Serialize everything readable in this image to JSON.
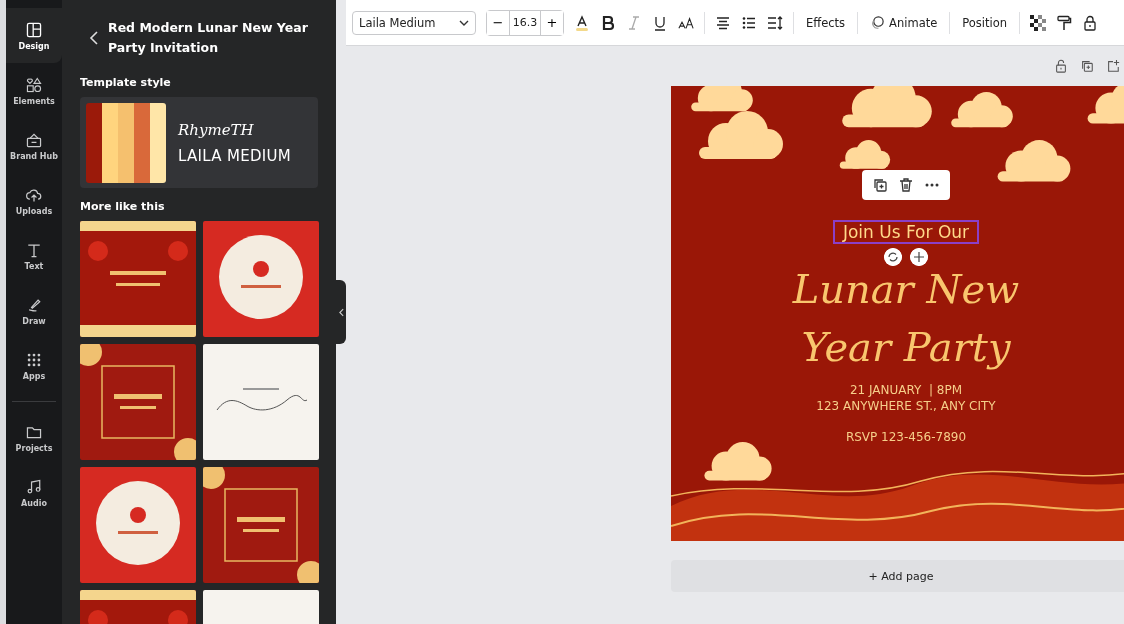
{
  "rail": [
    {
      "label": "Design",
      "selected": true
    },
    {
      "label": "Elements",
      "selected": false
    },
    {
      "label": "Brand Hub",
      "selected": false
    },
    {
      "label": "Uploads",
      "selected": false
    },
    {
      "label": "Text",
      "selected": false
    },
    {
      "label": "Draw",
      "selected": false
    },
    {
      "label": "Apps",
      "selected": false
    },
    {
      "label": "Projects",
      "selected": false
    },
    {
      "label": "Audio",
      "selected": false
    }
  ],
  "panel": {
    "title": "Red Modern Lunar New Year Party Invitation",
    "style_heading": "Template style",
    "swatches": [
      {
        "color": "#9b1a0a"
      },
      {
        "color": "#ffd47e"
      },
      {
        "color": "#f5c06e"
      },
      {
        "color": "#d9693a"
      },
      {
        "color": "#ffe6a8"
      }
    ],
    "script_font": "RhymeTH",
    "font": "LAILA MEDIUM",
    "more_heading": "More like this",
    "thumbnails": [
      {
        "kind": "lanterns"
      },
      {
        "kind": "circle"
      },
      {
        "kind": "frame"
      },
      {
        "kind": "plain"
      },
      {
        "kind": "circle"
      },
      {
        "kind": "frame"
      },
      {
        "kind": "lanterns"
      },
      {
        "kind": "plain"
      }
    ]
  },
  "toolbar": {
    "font": "Laila Medium",
    "minus": "−",
    "size": "16.3",
    "plus": "+",
    "italic_disabled": true,
    "effects": "Effects",
    "animate": "Animate",
    "position": "Position"
  },
  "design": {
    "selected_text": "Join Us For Our",
    "headline": [
      "Lunar New",
      "Year Party"
    ],
    "details": [
      "21 JANUARY  | 8PM",
      "123 ANYWHERE ST., ANY CITY"
    ],
    "rsvp": "RSVP 123-456-7890"
  },
  "add_page": "+ Add page"
}
